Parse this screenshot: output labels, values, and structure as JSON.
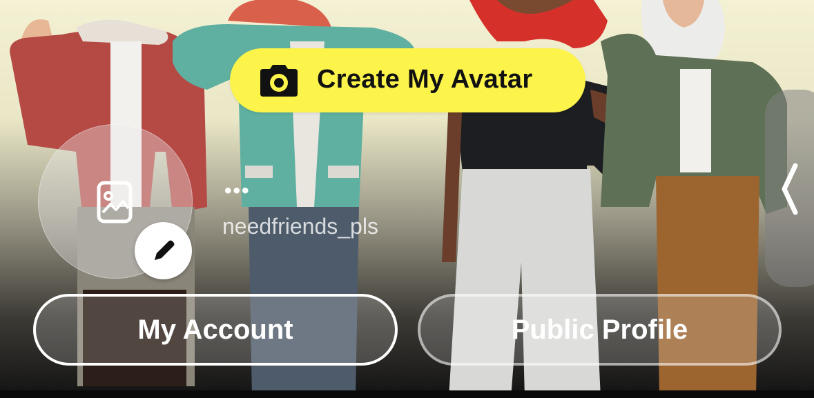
{
  "header": {
    "create_avatar_label": "Create My Avatar",
    "create_avatar_icon": "camera-icon",
    "accent_color": "#fcf44a"
  },
  "profile": {
    "display_name": "•••",
    "username": "needfriends_pls",
    "avatar_placeholder_icon": "photo-icon",
    "edit_icon": "pencil-icon"
  },
  "actions": {
    "my_account_label": "My Account",
    "public_profile_label": "Public Profile"
  },
  "side_panel": {
    "icon": "chevron-left-icon"
  }
}
